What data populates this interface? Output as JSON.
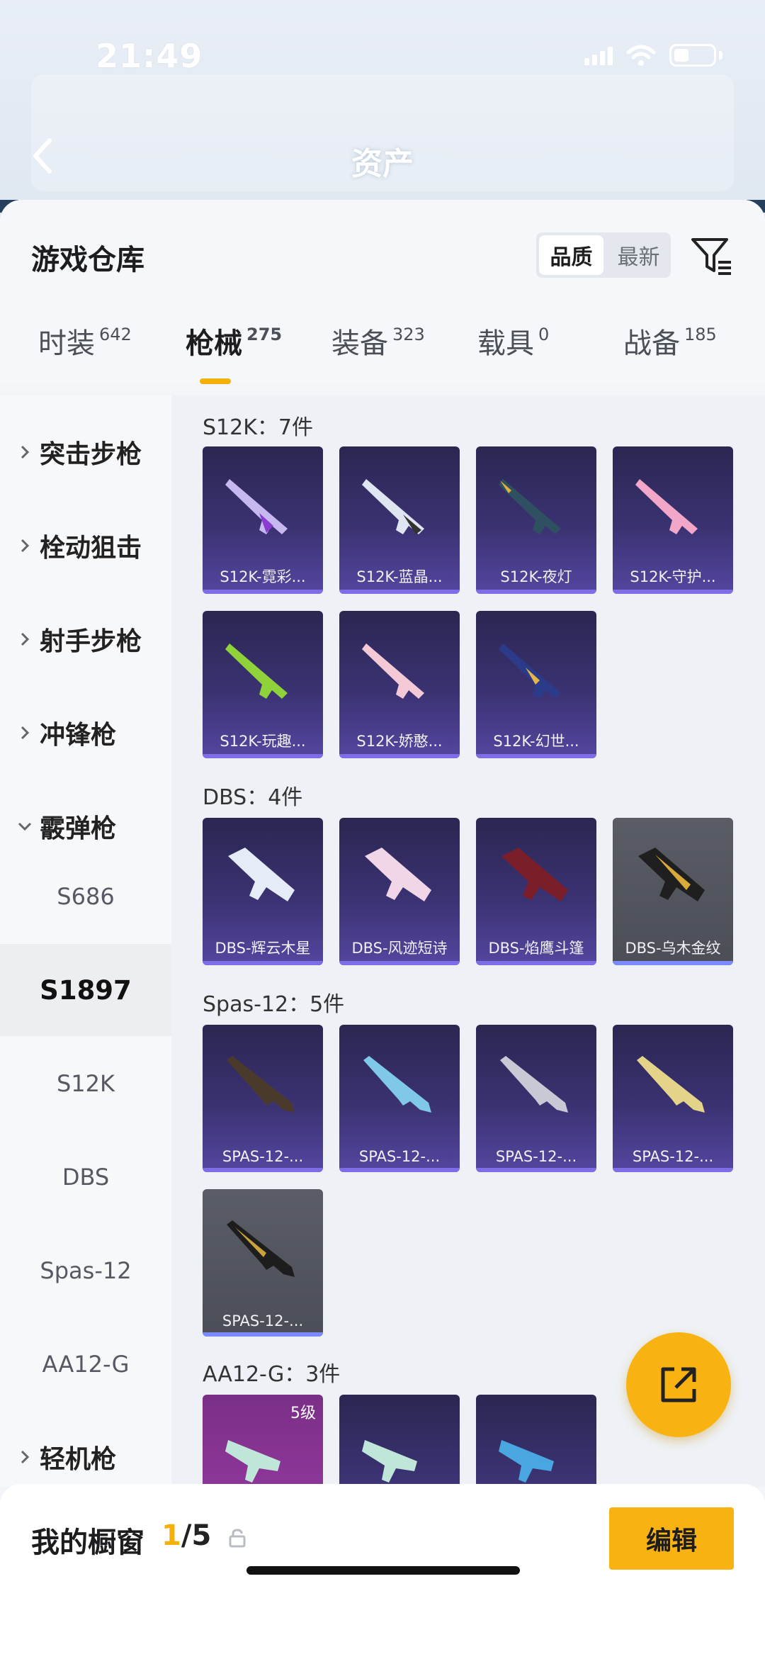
{
  "status": {
    "time": "21:49"
  },
  "header": {
    "title": "资产"
  },
  "sheet": {
    "title": "游戏仓库",
    "sort": {
      "quality": "品质",
      "latest": "最新"
    }
  },
  "tabs": [
    {
      "label": "时装",
      "count": "642"
    },
    {
      "label": "枪械",
      "count": "275"
    },
    {
      "label": "装备",
      "count": "323"
    },
    {
      "label": "载具",
      "count": "0"
    },
    {
      "label": "战备",
      "count": "185"
    }
  ],
  "sidebar": {
    "categories": [
      "突击步枪",
      "栓动狙击",
      "射手步枪",
      "冲锋枪",
      "霰弹枪",
      "轻机枪"
    ],
    "subs": [
      "S686",
      "S1897",
      "S12K",
      "DBS",
      "Spas-12",
      "AA12-G"
    ]
  },
  "groups": [
    {
      "title": "S12K：7件",
      "items": [
        "S12K-霓彩...",
        "S12K-蓝晶...",
        "S12K-夜灯",
        "S12K-守护...",
        "S12K-玩趣...",
        "S12K-娇憨...",
        "S12K-幻世..."
      ]
    },
    {
      "title": "DBS：4件",
      "items": [
        "DBS-辉云木星",
        "DBS-风迹短诗",
        "DBS-焰鹰斗篷",
        "DBS-乌木金纹"
      ]
    },
    {
      "title": "Spas-12：5件",
      "items": [
        "SPAS-12-...",
        "SPAS-12-...",
        "SPAS-12-...",
        "SPAS-12-...",
        "SPAS-12-..."
      ]
    },
    {
      "title": "AA12-G：3件",
      "level_badge": "5级"
    }
  ],
  "bottom": {
    "title": "我的橱窗",
    "count_current": "1",
    "count_total": "/5",
    "edit": "编辑"
  },
  "icons": [
    "back-arrow-icon",
    "filter-icon",
    "chevron-right-icon",
    "chevron-down-icon",
    "lock-icon",
    "share-icon"
  ],
  "colors": {
    "accent": "#f8b313",
    "card_purple": "#3b3272",
    "card_gray": "#4b4e57"
  }
}
